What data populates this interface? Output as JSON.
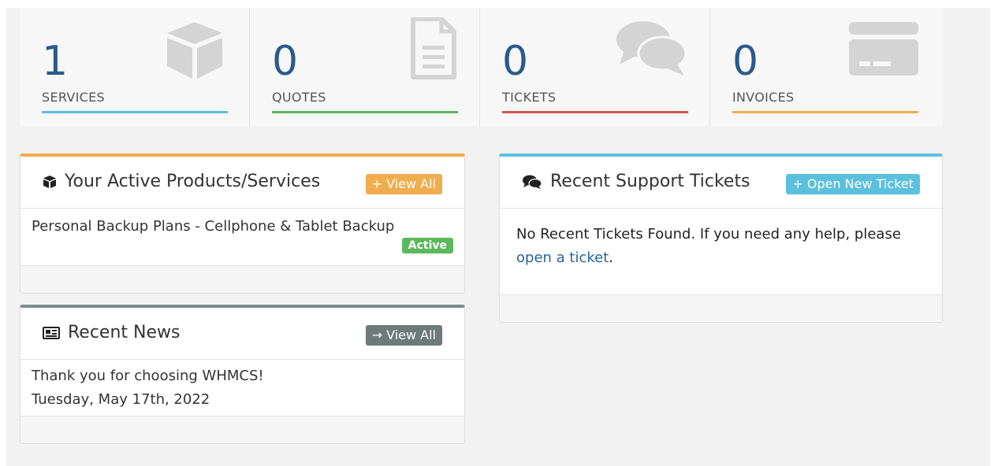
{
  "stats": [
    {
      "value": "1",
      "label": "SERVICES",
      "color": "#5bc0de",
      "icon": "cube-icon"
    },
    {
      "value": "0",
      "label": "QUOTES",
      "color": "#5cb85c",
      "icon": "file-icon"
    },
    {
      "value": "0",
      "label": "TICKETS",
      "color": "#d9534f",
      "icon": "comments-icon"
    },
    {
      "value": "0",
      "label": "INVOICES",
      "color": "#f0ad4e",
      "icon": "credit-card-icon"
    }
  ],
  "products_panel": {
    "title": "Your Active Products/Services",
    "button": "View All",
    "button_glyph": "+",
    "button_color": "#f0ad4e",
    "accent": "#f0ad4e",
    "item_name": "Personal Backup Plans - Cellphone & Tablet Backup",
    "item_status": "Active"
  },
  "news_panel": {
    "title": "Recent News",
    "button": "View All",
    "button_glyph": "→",
    "button_color": "#6c7a7a",
    "accent": "#7f8c8d",
    "headline": "Thank you for choosing WHMCS!",
    "date": "Tuesday, May 17th, 2022"
  },
  "tickets_panel": {
    "title": "Recent Support Tickets",
    "button": "Open New Ticket",
    "button_glyph": "+",
    "button_color": "#5bc0de",
    "accent": "#5bc0de",
    "message": "No Recent Tickets Found. If you need any help, please",
    "link_text": "open a ticket",
    "trailing": "."
  }
}
